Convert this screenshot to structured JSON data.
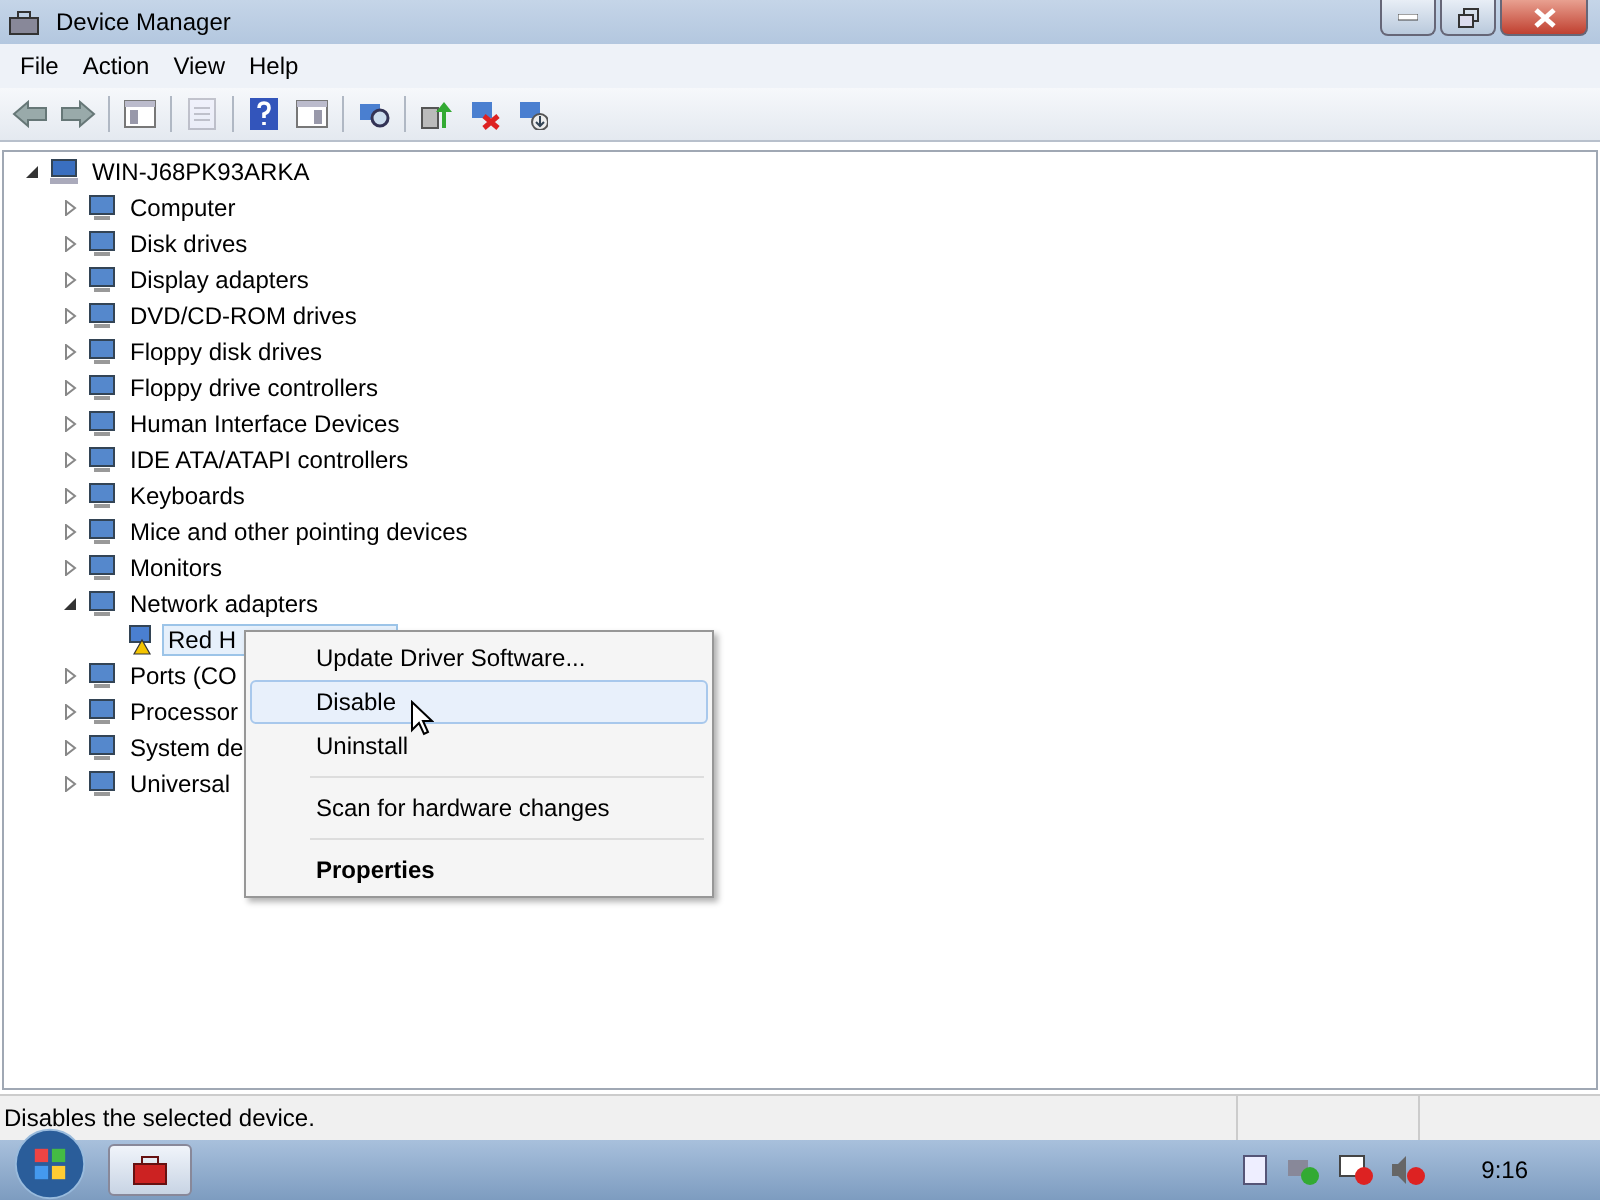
{
  "window": {
    "title": "Device Manager"
  },
  "menu_bar": [
    "File",
    "Action",
    "View",
    "Help"
  ],
  "toolbar": [
    {
      "kind": "back",
      "disabled": false
    },
    {
      "kind": "forward",
      "disabled": false
    },
    {
      "kind": "tree-pane",
      "disabled": false
    },
    {
      "kind": "properties",
      "disabled": true
    },
    {
      "kind": "help",
      "disabled": false
    },
    {
      "kind": "action-pane",
      "disabled": false
    },
    {
      "kind": "scan",
      "disabled": false
    },
    {
      "kind": "update",
      "disabled": false
    },
    {
      "kind": "disable",
      "disabled": false
    },
    {
      "kind": "uninstall",
      "disabled": false
    }
  ],
  "tree": {
    "label": "WIN-J68PK93ARKA",
    "expanded": true,
    "children": [
      {
        "label": "Computer",
        "expanded": false
      },
      {
        "label": "Disk drives",
        "expanded": false
      },
      {
        "label": "Display adapters",
        "expanded": false
      },
      {
        "label": "DVD/CD-ROM drives",
        "expanded": false
      },
      {
        "label": "Floppy disk drives",
        "expanded": false
      },
      {
        "label": "Floppy drive controllers",
        "expanded": false
      },
      {
        "label": "Human Interface Devices",
        "expanded": false
      },
      {
        "label": "IDE ATA/ATAPI controllers",
        "expanded": false
      },
      {
        "label": "Keyboards",
        "expanded": false
      },
      {
        "label": "Mice and other pointing devices",
        "expanded": false
      },
      {
        "label": "Monitors",
        "expanded": false
      },
      {
        "label": "Network adapters",
        "expanded": true,
        "children": [
          {
            "label": "Red H",
            "selected": true,
            "warning": true
          }
        ]
      },
      {
        "label": "Ports (CO",
        "expanded": false
      },
      {
        "label": "Processor",
        "expanded": false
      },
      {
        "label": "System de",
        "expanded": false
      },
      {
        "label": "Universal",
        "expanded": false
      }
    ]
  },
  "context_menu": [
    {
      "kind": "item",
      "label": "Update Driver Software...",
      "selected": false,
      "bold": false
    },
    {
      "kind": "item",
      "label": "Disable",
      "selected": true,
      "bold": false
    },
    {
      "kind": "item",
      "label": "Uninstall",
      "selected": false,
      "bold": false
    },
    {
      "kind": "separator"
    },
    {
      "kind": "item",
      "label": "Scan for hardware changes",
      "selected": false,
      "bold": false
    },
    {
      "kind": "separator"
    },
    {
      "kind": "item",
      "label": "Properties",
      "selected": false,
      "bold": true
    }
  ],
  "status_bar": "Disables the selected device.",
  "taskbar": {
    "clock": "9:16"
  }
}
